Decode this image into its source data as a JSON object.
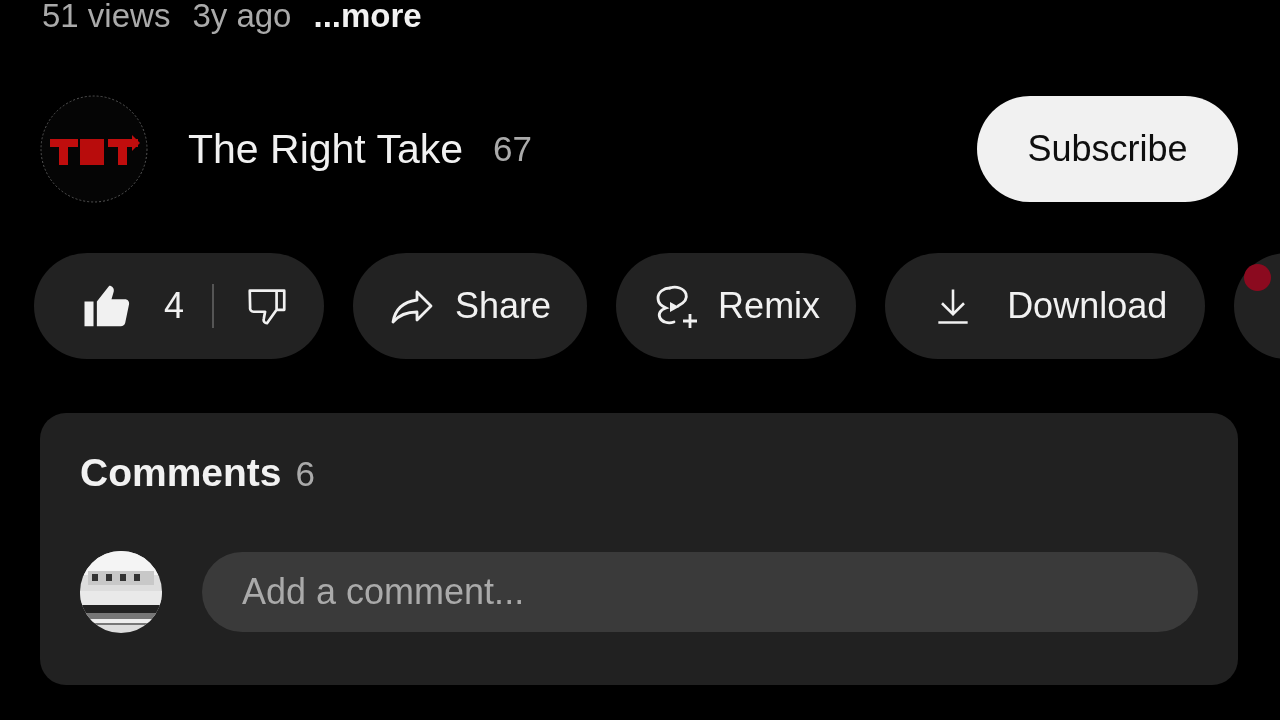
{
  "video_meta": {
    "views": "51 views",
    "age": "3y ago",
    "more_link": "...more"
  },
  "channel": {
    "name": "The Right Take",
    "subscriber_count": "67"
  },
  "subscribe_button": {
    "label": "Subscribe",
    "subscribed": false
  },
  "actions": [
    {
      "kind": "like-dislike",
      "like_count": "4"
    },
    {
      "kind": "share",
      "label": "Share"
    },
    {
      "kind": "remix",
      "label": "Remix"
    },
    {
      "kind": "download",
      "label": "Download"
    },
    {
      "kind": "partial"
    }
  ],
  "comments": {
    "title": "Comments",
    "count": "6",
    "input": {
      "placeholder": "Add a comment..."
    }
  }
}
